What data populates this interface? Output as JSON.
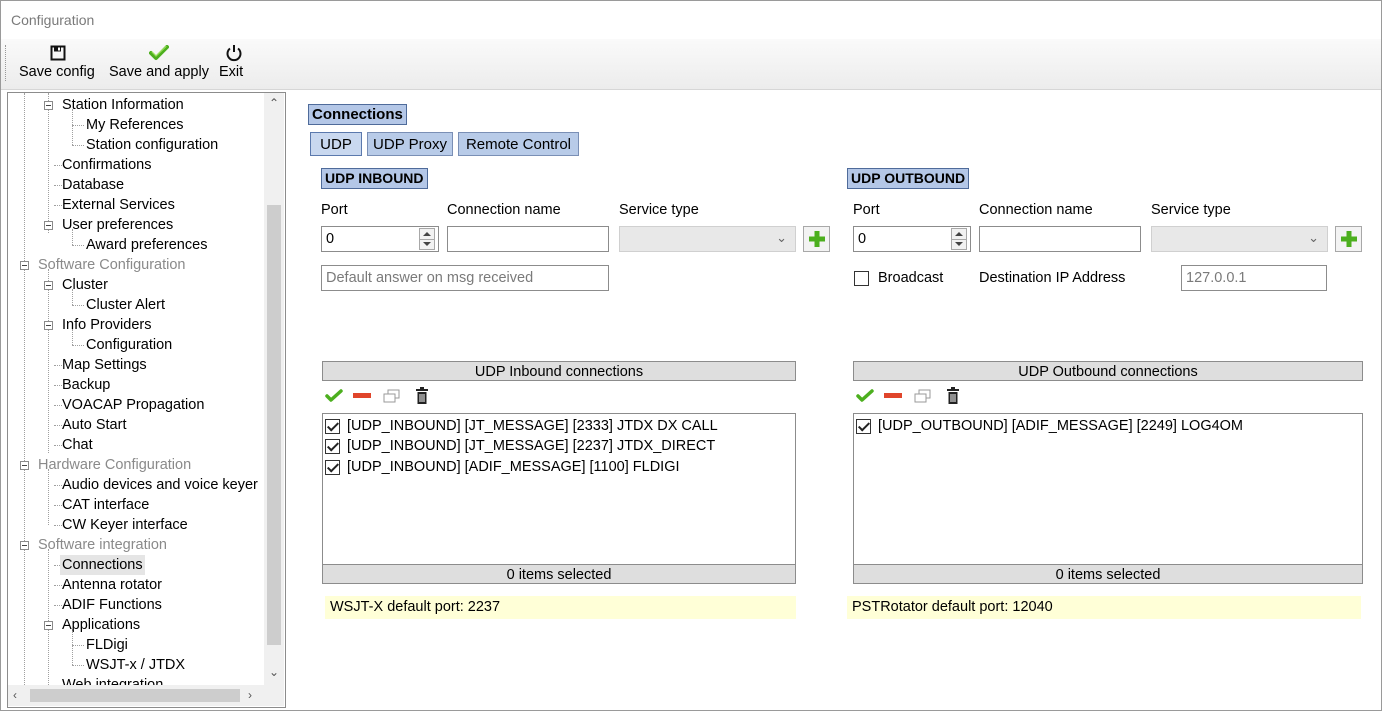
{
  "window": {
    "title": "Configuration"
  },
  "toolbar": {
    "save_config": "Save config",
    "save_apply": "Save and apply",
    "exit": "Exit"
  },
  "tree": {
    "items": [
      "Station Information",
      "My References",
      "Station configuration",
      "Confirmations",
      "Database",
      "External Services",
      "User preferences",
      "Award preferences",
      "Software Configuration",
      "Cluster",
      "Cluster Alert",
      "Info Providers",
      "Configuration",
      "Map Settings",
      "Backup",
      "VOACAP Propagation",
      "Auto Start",
      "Chat",
      "Hardware Configuration",
      "Audio devices and voice keyer",
      "CAT interface",
      "CW Keyer interface",
      "Software integration",
      "Connections",
      "Antenna rotator",
      "ADIF Functions",
      "Applications",
      "FLDigi",
      "WSJT-x / JTDX",
      "Web integration"
    ],
    "selected": "Connections"
  },
  "main": {
    "section_title": "Connections",
    "tabs": [
      "UDP",
      "UDP Proxy",
      "Remote Control"
    ],
    "active_tab": "UDP",
    "inbound": {
      "title": "UDP INBOUND",
      "port_label": "Port",
      "port_value": "0",
      "name_label": "Connection name",
      "name_value": "",
      "service_label": "Service type",
      "service_value": "",
      "default_answer_placeholder": "Default answer on msg received",
      "grid_title": "UDP Inbound connections",
      "rows": [
        {
          "checked": true,
          "text": "[UDP_INBOUND] [JT_MESSAGE] [2333] JTDX DX CALL"
        },
        {
          "checked": true,
          "text": "[UDP_INBOUND] [JT_MESSAGE] [2237] JTDX_DIRECT"
        },
        {
          "checked": true,
          "text": "[UDP_INBOUND] [ADIF_MESSAGE] [1100] FLDIGI"
        }
      ],
      "footer": "0 items selected",
      "hint": "WSJT-X default port: 2237"
    },
    "outbound": {
      "title": "UDP OUTBOUND",
      "port_label": "Port",
      "port_value": "0",
      "name_label": "Connection name",
      "name_value": "",
      "service_label": "Service type",
      "service_value": "",
      "broadcast_label": "Broadcast",
      "broadcast_checked": false,
      "dest_label": "Destination IP Address",
      "dest_value": "127.0.0.1",
      "grid_title": "UDP Outbound connections",
      "rows": [
        {
          "checked": true,
          "text": "[UDP_OUTBOUND] [ADIF_MESSAGE] [2249] LOG4OM"
        }
      ],
      "footer": "0 items selected",
      "hint": "PSTRotator default port: 12040"
    }
  },
  "colors": {
    "section_bg": "#b4c7e7",
    "hint_bg": "#ffffd7",
    "check_green": "#4caf1e",
    "remove_red": "#e0452b"
  }
}
